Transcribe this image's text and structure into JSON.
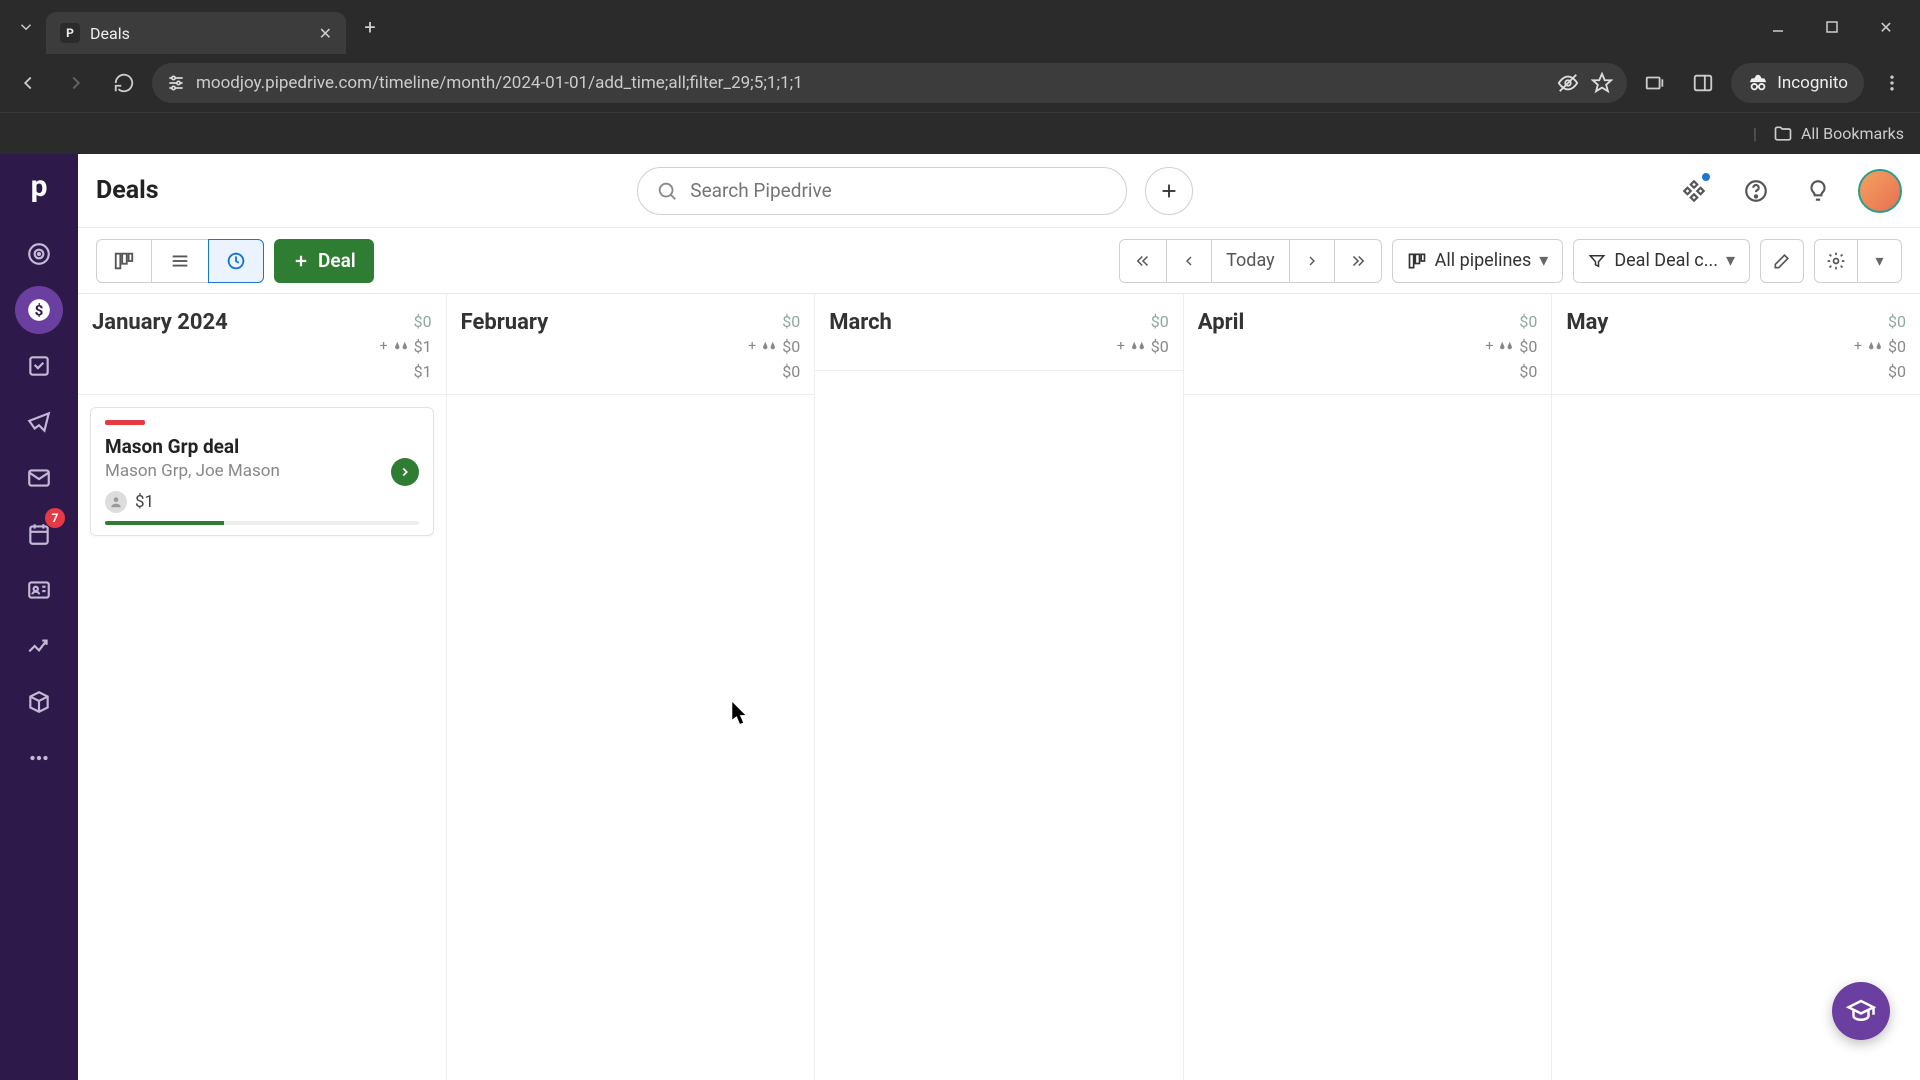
{
  "browser": {
    "tab_title": "Deals",
    "url": "moodjoy.pipedrive.com/timeline/month/2024-01-01/add_time;all;filter_29;5;1;1;1",
    "incognito_label": "Incognito",
    "all_bookmarks": "All Bookmarks"
  },
  "header": {
    "title": "Deals",
    "search_placeholder": "Search Pipedrive"
  },
  "sidebar": {
    "badge_activities": "7"
  },
  "toolbar": {
    "add_deal": "Deal",
    "today": "Today",
    "pipelines": "All pipelines",
    "filter_label": "Deal Deal c..."
  },
  "months": [
    {
      "name": "January 2024",
      "total_dim": "$0",
      "weighted": "$1",
      "bottom": "$1",
      "has_plus": true
    },
    {
      "name": "February",
      "total_dim": "$0",
      "weighted": "$0",
      "bottom": "$0",
      "has_plus": true
    },
    {
      "name": "March",
      "total_dim": "$0",
      "weighted": "$0",
      "bottom": "",
      "has_plus": true
    },
    {
      "name": "April",
      "total_dim": "$0",
      "weighted": "$0",
      "bottom": "$0",
      "has_plus": true
    },
    {
      "name": "May",
      "total_dim": "$0",
      "weighted": "$0",
      "bottom": "$0",
      "has_plus": true
    }
  ],
  "deal": {
    "title": "Mason Grp deal",
    "subtitle": "Mason Grp, Joe Mason",
    "amount": "$1"
  }
}
